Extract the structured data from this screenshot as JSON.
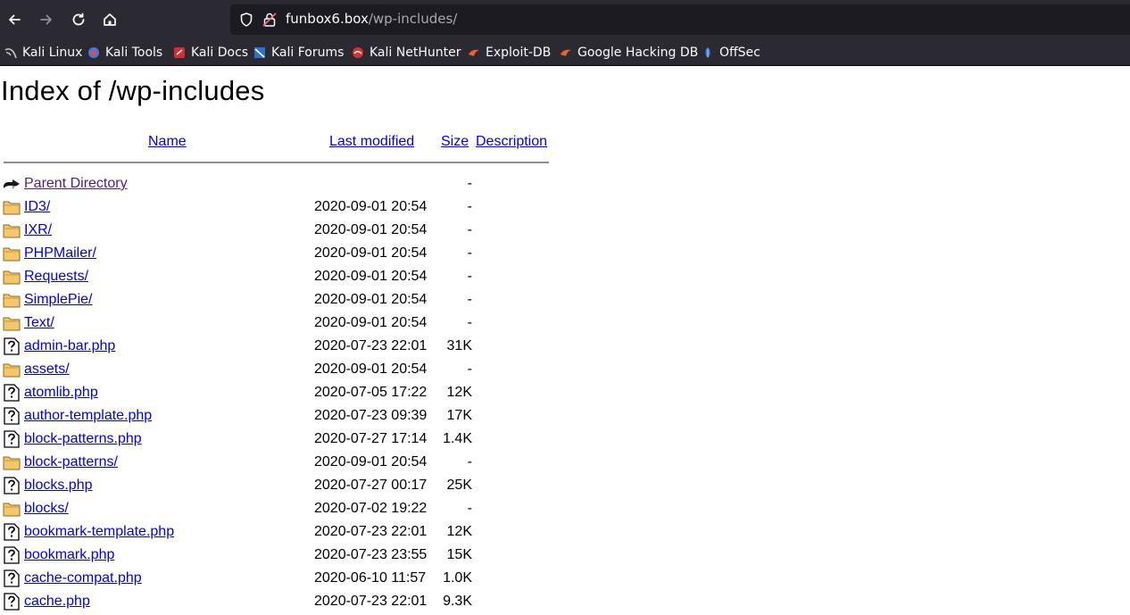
{
  "browser": {
    "url_host": "funbox6.box",
    "url_path": "/wp-includes/",
    "bookmarks": [
      {
        "label": "Kali Linux",
        "icon": "kali-dragon-icon"
      },
      {
        "label": "Kali Tools",
        "icon": "kali-tools-icon"
      },
      {
        "label": "Kali Docs",
        "icon": "kali-docs-icon"
      },
      {
        "label": "Kali Forums",
        "icon": "kali-forums-icon"
      },
      {
        "label": "Kali NetHunter",
        "icon": "nethunter-icon"
      },
      {
        "label": "Exploit-DB",
        "icon": "exploitdb-icon"
      },
      {
        "label": "Google Hacking DB",
        "icon": "ghdb-icon"
      },
      {
        "label": "OffSec",
        "icon": "offsec-icon"
      }
    ]
  },
  "page": {
    "title": "Index of /wp-includes",
    "headers": {
      "name": "Name",
      "last_modified": "Last modified",
      "size": "Size",
      "description": "Description"
    },
    "rows": [
      {
        "type": "parent",
        "name": "Parent Directory",
        "date": "",
        "size": "-"
      },
      {
        "type": "folder",
        "name": "ID3/",
        "date": "2020-09-01 20:54",
        "size": "-"
      },
      {
        "type": "folder",
        "name": "IXR/",
        "date": "2020-09-01 20:54",
        "size": "-"
      },
      {
        "type": "folder",
        "name": "PHPMailer/",
        "date": "2020-09-01 20:54",
        "size": "-"
      },
      {
        "type": "folder",
        "name": "Requests/",
        "date": "2020-09-01 20:54",
        "size": "-"
      },
      {
        "type": "folder",
        "name": "SimplePie/",
        "date": "2020-09-01 20:54",
        "size": "-"
      },
      {
        "type": "folder",
        "name": "Text/",
        "date": "2020-09-01 20:54",
        "size": "-"
      },
      {
        "type": "file",
        "name": "admin-bar.php",
        "date": "2020-07-23 22:01",
        "size": "31K"
      },
      {
        "type": "folder",
        "name": "assets/",
        "date": "2020-09-01 20:54",
        "size": "-"
      },
      {
        "type": "file",
        "name": "atomlib.php",
        "date": "2020-07-05 17:22",
        "size": "12K"
      },
      {
        "type": "file",
        "name": "author-template.php",
        "date": "2020-07-23 09:39",
        "size": "17K"
      },
      {
        "type": "file",
        "name": "block-patterns.php",
        "date": "2020-07-27 17:14",
        "size": "1.4K"
      },
      {
        "type": "folder",
        "name": "block-patterns/",
        "date": "2020-09-01 20:54",
        "size": "-"
      },
      {
        "type": "file",
        "name": "blocks.php",
        "date": "2020-07-27 00:17",
        "size": "25K"
      },
      {
        "type": "folder",
        "name": "blocks/",
        "date": "2020-07-02 19:22",
        "size": "-"
      },
      {
        "type": "file",
        "name": "bookmark-template.php",
        "date": "2020-07-23 22:01",
        "size": "12K"
      },
      {
        "type": "file",
        "name": "bookmark.php",
        "date": "2020-07-23 23:55",
        "size": "15K"
      },
      {
        "type": "file",
        "name": "cache-compat.php",
        "date": "2020-06-10 11:57",
        "size": "1.0K"
      },
      {
        "type": "file",
        "name": "cache.php",
        "date": "2020-07-23 22:01",
        "size": "9.3K"
      }
    ]
  }
}
